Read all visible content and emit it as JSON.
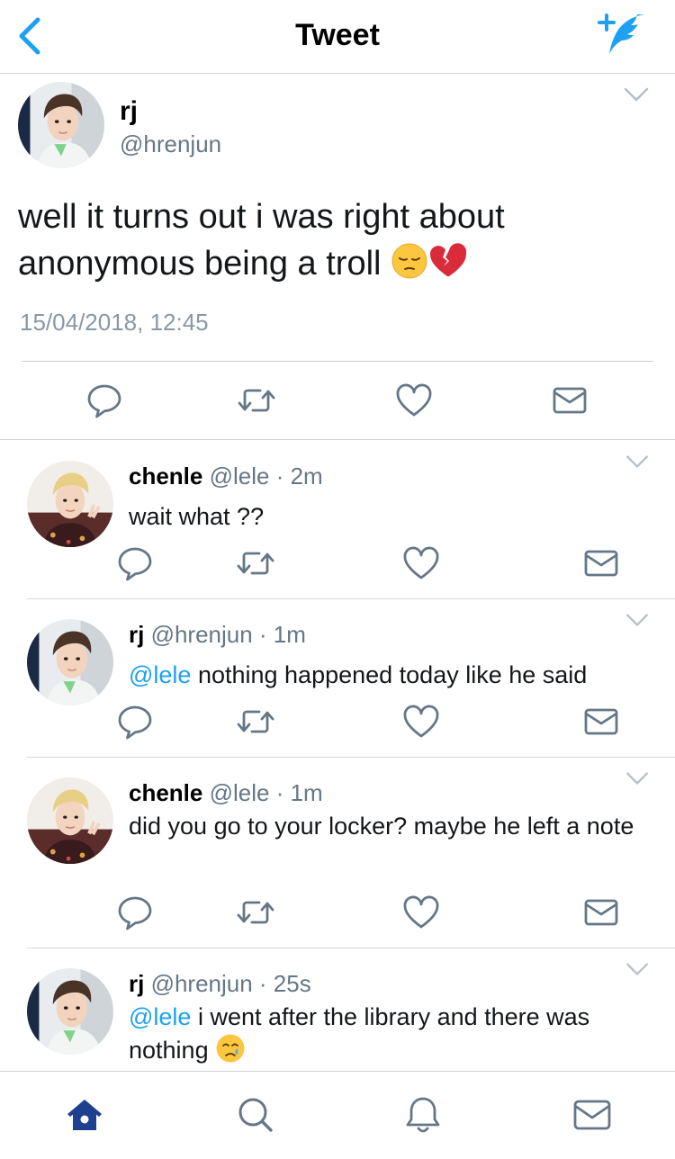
{
  "header": {
    "title": "Tweet",
    "back_icon": "back-chevron-icon",
    "compose_icon": "compose-tweet-icon"
  },
  "main_tweet": {
    "name": "rj",
    "handle": "@hrenjun",
    "text_line1": "well it turns out i was right about",
    "text_line2": "anonymous being a troll",
    "emojis": [
      "pensive-face-emoji",
      "broken-heart-emoji"
    ],
    "timestamp": "15/04/2018, 12:45"
  },
  "replies": [
    {
      "name": "chenle",
      "meta": "@lele · 2m",
      "mention": "",
      "text": "wait what ??"
    },
    {
      "name": "rj",
      "meta": "@hrenjun · 1m",
      "mention": "@lele",
      "text": " nothing happened today like he said"
    },
    {
      "name": "chenle",
      "meta": "@lele · 1m",
      "mention": "",
      "text": "did you go to your locker? maybe he left a note"
    },
    {
      "name": "rj",
      "meta": "@hrenjun · 25s",
      "mention": "@lele",
      "text": " i went after the library and there was nothing",
      "emoji": "crying-face-emoji"
    }
  ],
  "tabbar": {
    "items": [
      "home-icon",
      "search-icon",
      "notifications-icon",
      "messages-icon"
    ],
    "active_color": "#1f3f8f",
    "inactive_color": "#657786"
  },
  "colors": {
    "accent": "#1da1f2",
    "muted": "#657786",
    "divider": "#d8d8d8"
  }
}
